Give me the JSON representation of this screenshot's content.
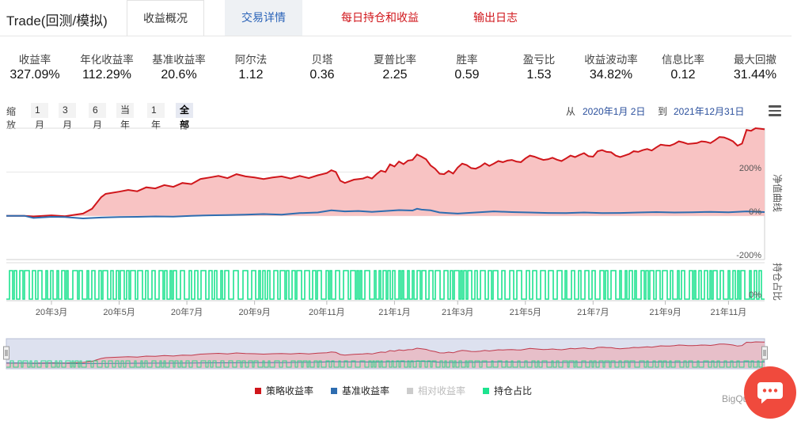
{
  "header": {
    "app_title": "Trade(回测/模拟)",
    "tabs": [
      {
        "label": "收益概况"
      },
      {
        "label": "交易详情"
      },
      {
        "label": "每日持仓和收益"
      },
      {
        "label": "输出日志"
      }
    ]
  },
  "metrics": [
    {
      "label": "收益率",
      "value": "327.09%"
    },
    {
      "label": "年化收益率",
      "value": "112.29%"
    },
    {
      "label": "基准收益率",
      "value": "20.6%"
    },
    {
      "label": "阿尔法",
      "value": "1.12"
    },
    {
      "label": "贝塔",
      "value": "0.36"
    },
    {
      "label": "夏普比率",
      "value": "2.25"
    },
    {
      "label": "胜率",
      "value": "0.59"
    },
    {
      "label": "盈亏比",
      "value": "1.53"
    },
    {
      "label": "收益波动率",
      "value": "34.82%"
    },
    {
      "label": "信息比率",
      "value": "0.12"
    },
    {
      "label": "最大回撤",
      "value": "31.44%"
    }
  ],
  "zoom": {
    "label": "缩放",
    "buttons": [
      "1月",
      "3月",
      "6月",
      "当年",
      "1年",
      "全部"
    ],
    "active": "全部"
  },
  "range": {
    "from_label": "从",
    "from_date": "2020年1月 2日",
    "to_label": "到",
    "to_date": "2021年12月31日"
  },
  "colors": {
    "strategy": "#d0161b",
    "benchmark": "#2e6db0",
    "relative": "#cccccc",
    "position": "#1de38f",
    "strategy_fill": "#f8c3c3"
  },
  "chart_data": {
    "type": "line",
    "x_labels": [
      "20年3月",
      "20年5月",
      "20年7月",
      "20年9月",
      "20年11月",
      "21年1月",
      "21年3月",
      "21年5月",
      "21年7月",
      "21年9月",
      "21年11月"
    ],
    "x_range": [
      "2020-01-02",
      "2021-12-31"
    ],
    "main_y_ticks": [
      "200%",
      "0%",
      "-200%"
    ],
    "main_ylim": [
      -200,
      400
    ],
    "sub_y_ticks": [
      "0%"
    ],
    "main_side_title": "净值曲线",
    "sub_side_title": "持仓占比",
    "legend_position": "bottom",
    "series": [
      {
        "name": "策略收益率",
        "points": [
          [
            0,
            0
          ],
          [
            4,
            0
          ],
          [
            6,
            -3
          ],
          [
            10,
            2
          ],
          [
            13,
            -2
          ],
          [
            17,
            10
          ],
          [
            19,
            32
          ],
          [
            21,
            85
          ],
          [
            22,
            100
          ],
          [
            25,
            110
          ],
          [
            27,
            118
          ],
          [
            29,
            112
          ],
          [
            31,
            130
          ],
          [
            33,
            125
          ],
          [
            35,
            140
          ],
          [
            37,
            132
          ],
          [
            39,
            150
          ],
          [
            41,
            145
          ],
          [
            43,
            168
          ],
          [
            45,
            175
          ],
          [
            47,
            182
          ],
          [
            49,
            172
          ],
          [
            51,
            190
          ],
          [
            53,
            180
          ],
          [
            55,
            175
          ],
          [
            57,
            168
          ],
          [
            59,
            175
          ],
          [
            61,
            180
          ],
          [
            63,
            170
          ],
          [
            65,
            182
          ],
          [
            67,
            172
          ],
          [
            69,
            185
          ],
          [
            71,
            195
          ],
          [
            72,
            208
          ],
          [
            73,
            200
          ],
          [
            74,
            160
          ],
          [
            75,
            150
          ],
          [
            77,
            165
          ],
          [
            79,
            170
          ],
          [
            80,
            178
          ],
          [
            81,
            170
          ],
          [
            82,
            190
          ],
          [
            83,
            206
          ],
          [
            84,
            200
          ],
          [
            85,
            235
          ],
          [
            86,
            225
          ],
          [
            87,
            248
          ],
          [
            88,
            236
          ],
          [
            89,
            252
          ],
          [
            90,
            255
          ],
          [
            91,
            280
          ],
          [
            92,
            270
          ],
          [
            93,
            258
          ],
          [
            94,
            230
          ],
          [
            95,
            215
          ],
          [
            96,
            192
          ],
          [
            97,
            190
          ],
          [
            98,
            205
          ],
          [
            99,
            193
          ],
          [
            100,
            220
          ],
          [
            101,
            238
          ],
          [
            102,
            232
          ],
          [
            103,
            218
          ],
          [
            104,
            215
          ],
          [
            105,
            225
          ],
          [
            106,
            240
          ],
          [
            107,
            228
          ],
          [
            108,
            238
          ],
          [
            109,
            250
          ],
          [
            110,
            245
          ],
          [
            111,
            252
          ],
          [
            112,
            255
          ],
          [
            113,
            248
          ],
          [
            114,
            245
          ],
          [
            115,
            262
          ],
          [
            116,
            275
          ],
          [
            117,
            270
          ],
          [
            118,
            262
          ],
          [
            119,
            255
          ],
          [
            120,
            258
          ],
          [
            121,
            265
          ],
          [
            122,
            256
          ],
          [
            123,
            250
          ],
          [
            124,
            262
          ],
          [
            125,
            275
          ],
          [
            126,
            268
          ],
          [
            127,
            278
          ],
          [
            128,
            286
          ],
          [
            129,
            272
          ],
          [
            130,
            270
          ],
          [
            131,
            295
          ],
          [
            132,
            300
          ],
          [
            133,
            292
          ],
          [
            134,
            290
          ],
          [
            135,
            275
          ],
          [
            136,
            268
          ],
          [
            137,
            275
          ],
          [
            138,
            282
          ],
          [
            139,
            295
          ],
          [
            140,
            292
          ],
          [
            141,
            300
          ],
          [
            142,
            305
          ],
          [
            143,
            298
          ],
          [
            144,
            312
          ],
          [
            145,
            325
          ],
          [
            146,
            322
          ],
          [
            147,
            320
          ],
          [
            148,
            328
          ],
          [
            149,
            340
          ],
          [
            150,
            335
          ],
          [
            151,
            328
          ],
          [
            152,
            330
          ],
          [
            153,
            332
          ],
          [
            154,
            340
          ],
          [
            155,
            338
          ],
          [
            156,
            332
          ],
          [
            157,
            345
          ],
          [
            158,
            360
          ],
          [
            159,
            358
          ],
          [
            160,
            350
          ],
          [
            161,
            340
          ],
          [
            162,
            320
          ],
          [
            163,
            330
          ],
          [
            164,
            392
          ],
          [
            165,
            388
          ],
          [
            166,
            400
          ],
          [
            167,
            398
          ],
          [
            168,
            395
          ]
        ]
      },
      {
        "name": "基准收益率",
        "points": [
          [
            0,
            0
          ],
          [
            4,
            0
          ],
          [
            6,
            -10
          ],
          [
            10,
            -5
          ],
          [
            13,
            -6
          ],
          [
            17,
            -12
          ],
          [
            21,
            -8
          ],
          [
            25,
            -6
          ],
          [
            29,
            -5
          ],
          [
            33,
            -3
          ],
          [
            37,
            -4
          ],
          [
            41,
            0
          ],
          [
            45,
            2
          ],
          [
            49,
            3
          ],
          [
            53,
            5
          ],
          [
            57,
            8
          ],
          [
            61,
            5
          ],
          [
            65,
            12
          ],
          [
            69,
            15
          ],
          [
            72,
            25
          ],
          [
            75,
            20
          ],
          [
            78,
            22
          ],
          [
            81,
            18
          ],
          [
            84,
            22
          ],
          [
            87,
            26
          ],
          [
            90,
            24
          ],
          [
            91,
            32
          ],
          [
            92,
            28
          ],
          [
            94,
            25
          ],
          [
            96,
            15
          ],
          [
            98,
            12
          ],
          [
            100,
            10
          ],
          [
            104,
            15
          ],
          [
            108,
            20
          ],
          [
            112,
            17
          ],
          [
            116,
            15
          ],
          [
            120,
            13
          ],
          [
            124,
            12
          ],
          [
            128,
            15
          ],
          [
            132,
            12
          ],
          [
            136,
            13
          ],
          [
            140,
            15
          ],
          [
            144,
            17
          ],
          [
            148,
            15
          ],
          [
            152,
            16
          ],
          [
            156,
            18
          ],
          [
            160,
            16
          ],
          [
            164,
            20
          ],
          [
            168,
            17
          ]
        ]
      },
      {
        "name": "相对收益率",
        "points": []
      },
      {
        "name": "持仓占比",
        "points": []
      }
    ]
  },
  "watermark": "BigQu"
}
